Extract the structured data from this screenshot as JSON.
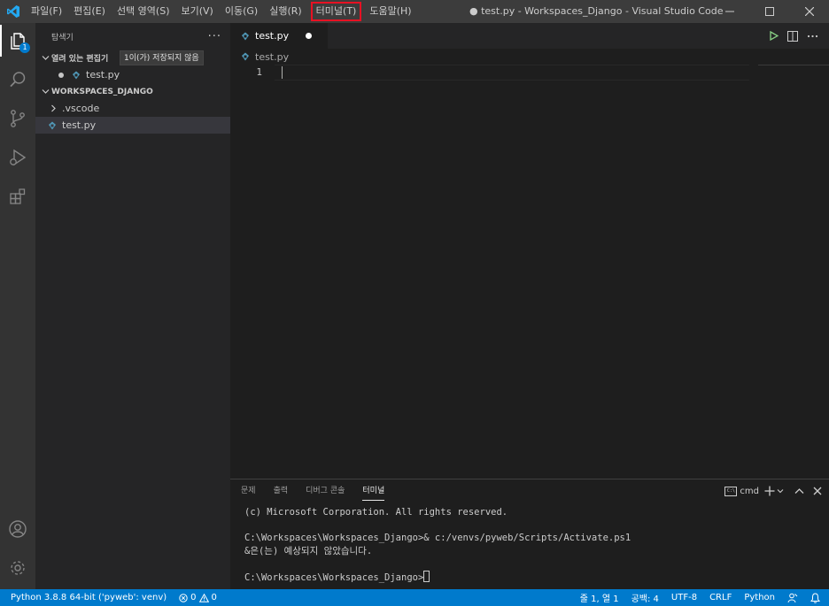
{
  "titlebar": {
    "menus": [
      "파일(F)",
      "편집(E)",
      "선택 영역(S)",
      "보기(V)",
      "이동(G)",
      "실행(R)",
      "터미널(T)",
      "도움말(H)"
    ],
    "highlighted_menu": "터미널(T)",
    "title": "● test.py - Workspaces_Django - Visual Studio Code"
  },
  "activitybar": {
    "items": [
      "explorer-icon",
      "search-icon",
      "source-control-icon",
      "run-debug-icon",
      "extensions-icon"
    ],
    "explorer_badge": "1",
    "bottom_items": [
      "account-icon",
      "gear-icon"
    ]
  },
  "sidebar": {
    "title": "탐색기",
    "more": "···",
    "open_editors": {
      "label": "열려 있는 편집기",
      "tooltip": "1이(가) 저장되지 않음",
      "files": [
        "test.py"
      ]
    },
    "workspace": {
      "label": "WORKSPACES_DJANGO",
      "folders": [
        ".vscode"
      ],
      "files": [
        "test.py"
      ]
    }
  },
  "editor": {
    "tab_label": "test.py",
    "breadcrumb": "test.py",
    "line_number": "1"
  },
  "panel": {
    "tabs": [
      "문제",
      "출력",
      "디버그 콘솔",
      "터미널"
    ],
    "active_tab": "터미널",
    "shell": "cmd",
    "terminal_lines": [
      "(c) Microsoft Corporation. All rights reserved.",
      "",
      "C:\\Workspaces\\Workspaces_Django>& c:/venvs/pyweb/Scripts/Activate.ps1",
      "&은(는) 예상되지 않았습니다.",
      "",
      "C:\\Workspaces\\Workspaces_Django>"
    ]
  },
  "statusbar": {
    "interpreter": "Python 3.8.8 64-bit ('pyweb': venv)",
    "errors": "0",
    "warnings": "0",
    "position": "줄 1, 열 1",
    "indent": "공백: 4",
    "encoding": "UTF-8",
    "eol": "CRLF",
    "language": "Python"
  },
  "colors": {
    "accent": "#007acc",
    "highlight_outline": "#e81123",
    "python_icon": "#519aba"
  }
}
